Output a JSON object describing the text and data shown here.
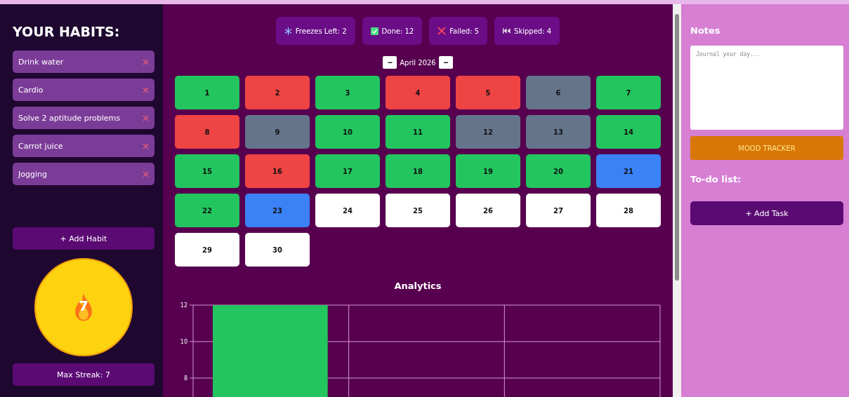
{
  "sidebar": {
    "title": "YOUR HABITS:",
    "habits": [
      {
        "name": "Drink water"
      },
      {
        "name": "Cardio"
      },
      {
        "name": "Solve 2 aptitude problems"
      },
      {
        "name": "Carrot juice"
      },
      {
        "name": "Jogging"
      }
    ],
    "add_button": "+ Add Habit",
    "streak": "7",
    "max_streak": "Max Streak: 7"
  },
  "stats": [
    {
      "kind": "freeze",
      "label": "Freezes Left: 2"
    },
    {
      "kind": "done",
      "label": "Done: 12"
    },
    {
      "kind": "failed",
      "label": "Failed: 5"
    },
    {
      "kind": "skipped",
      "label": "Skipped: 4"
    }
  ],
  "calendar": {
    "prev": "−",
    "month": "April 2026",
    "next": "−",
    "days": [
      {
        "day": "1",
        "kind": "done"
      },
      {
        "day": "2",
        "kind": "failed"
      },
      {
        "day": "3",
        "kind": "done"
      },
      {
        "day": "4",
        "kind": "failed"
      },
      {
        "day": "5",
        "kind": "failed"
      },
      {
        "day": "6",
        "kind": "skipped"
      },
      {
        "day": "7",
        "kind": "done"
      },
      {
        "day": "8",
        "kind": "failed"
      },
      {
        "day": "9",
        "kind": "skipped"
      },
      {
        "day": "10",
        "kind": "done"
      },
      {
        "day": "11",
        "kind": "done"
      },
      {
        "day": "12",
        "kind": "skipped"
      },
      {
        "day": "13",
        "kind": "skipped"
      },
      {
        "day": "14",
        "kind": "done"
      },
      {
        "day": "15",
        "kind": "done"
      },
      {
        "day": "16",
        "kind": "failed"
      },
      {
        "day": "17",
        "kind": "done"
      },
      {
        "day": "18",
        "kind": "done"
      },
      {
        "day": "19",
        "kind": "done"
      },
      {
        "day": "20",
        "kind": "done"
      },
      {
        "day": "21",
        "kind": "frozen"
      },
      {
        "day": "22",
        "kind": "done"
      },
      {
        "day": "23",
        "kind": "frozen"
      },
      {
        "day": "24",
        "kind": "none"
      },
      {
        "day": "25",
        "kind": "none"
      },
      {
        "day": "26",
        "kind": "none"
      },
      {
        "day": "27",
        "kind": "none"
      },
      {
        "day": "28",
        "kind": "none"
      },
      {
        "day": "29",
        "kind": "none"
      },
      {
        "day": "30",
        "kind": "none"
      }
    ]
  },
  "analytics": {
    "title": "Analytics",
    "chart_data": {
      "type": "bar",
      "series": [
        {
          "color": "#22c55e",
          "values": [
            12
          ]
        }
      ],
      "ylim": [
        0,
        12
      ],
      "yticks": [
        8,
        10,
        12
      ]
    }
  },
  "notes": {
    "title": "Notes",
    "placeholder": "Journal your day...",
    "mood_button": "MOOD TRACKER"
  },
  "todo": {
    "title": "To-do list:",
    "add_button": "+ Add Task"
  }
}
